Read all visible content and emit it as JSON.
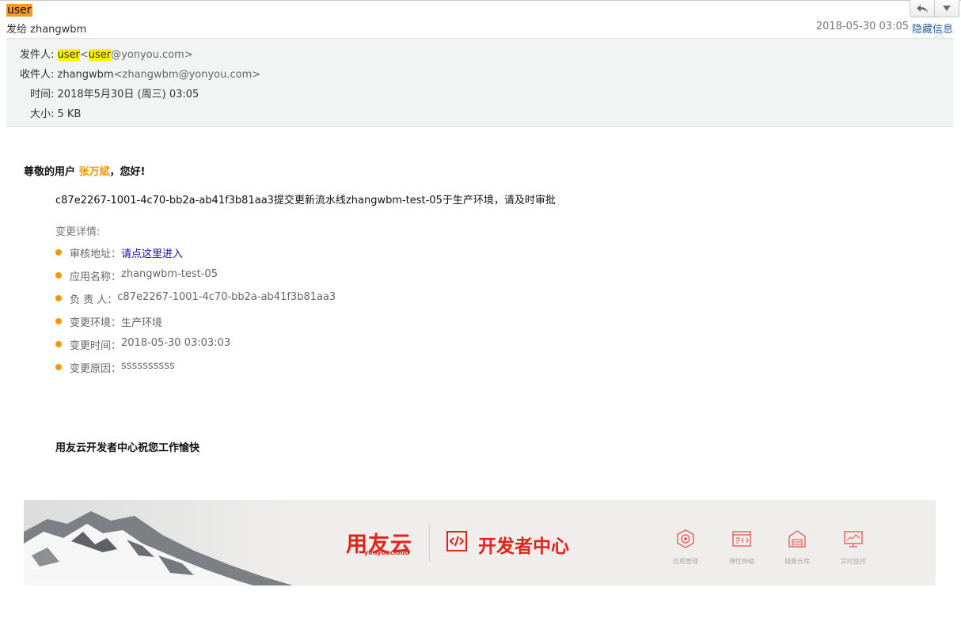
{
  "email": {
    "subject": "user",
    "send_to": "发给 zhangwbm",
    "date": "2018-05-30 03:05",
    "hide_info_label": "隐藏信息"
  },
  "header": {
    "from_label": "发件人:",
    "from_name": "user",
    "from_lt": "<",
    "from_user": "user",
    "from_domain": "@yonyou.com>",
    "to_label": "收件人:",
    "to_name": "zhangwbm",
    "to_addr": "<zhangwbm@yonyou.com>",
    "time_label": "时间:",
    "time_value": "2018年5月30日 (周三) 03:05",
    "size_label": "大小:",
    "size_value": "5 KB"
  },
  "body": {
    "greeting_prefix": "尊敬的用户 ",
    "greeting_name": "张万斌",
    "greeting_suffix": "，您好!",
    "message": "c87e2267-1001-4c70-bb2a-ab41f3b81aa3提交更新流水线zhangwbm-test-05于生产环境，请及时审批",
    "details_title": "变更详情:",
    "details": [
      {
        "label": "审核地址：",
        "value": "请点这里进入",
        "link": true
      },
      {
        "label": "应用名称：",
        "value": "zhangwbm-test-05"
      },
      {
        "label": "负 责 人：",
        "value": "c87e2267-1001-4c70-bb2a-ab41f3b81aa3"
      },
      {
        "label": "变更环境：",
        "value": "生产环境"
      },
      {
        "label": "变更时间：",
        "value": "2018-05-30 03:03:03"
      },
      {
        "label": "变更原因：",
        "value": "ssssssssss"
      }
    ],
    "closing": "用友云开发者中心祝您工作愉快"
  },
  "banner": {
    "logo": "用友云",
    "logo_sub": "yonyoucloud",
    "title": "开发者中心",
    "features": [
      {
        "label": "应用管理",
        "icon": "gear-hexagon-icon"
      },
      {
        "label": "弹性伸缩",
        "icon": "code-window-icon"
      },
      {
        "label": "镜像仓库",
        "icon": "warehouse-icon"
      },
      {
        "label": "实时监控",
        "icon": "monitor-chart-icon"
      }
    ],
    "accent": "#e2231a"
  },
  "colors": {
    "highlight": "#fff200",
    "orange": "#f39800",
    "link": "#1a0dab"
  }
}
